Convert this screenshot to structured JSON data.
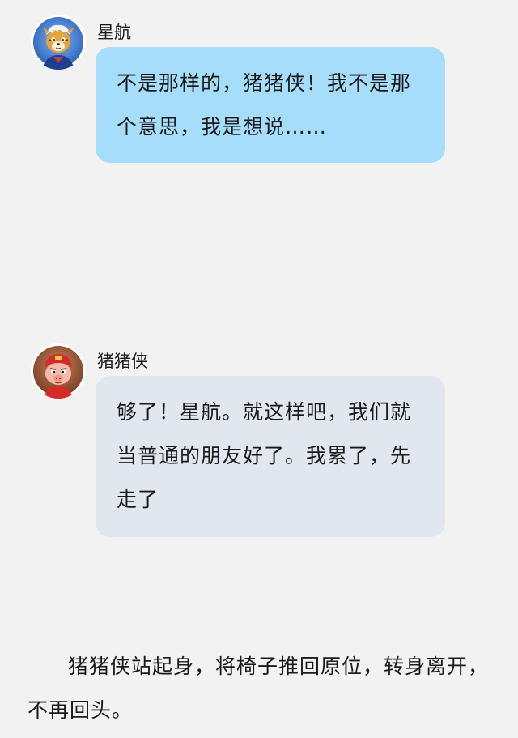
{
  "messages": [
    {
      "sender": "星航",
      "avatar_icon": "tiger-character-avatar",
      "bubble_color": "#a5ddfb",
      "text": "不是那样的，猪猪侠！我不是那个意思，我是想说……"
    },
    {
      "sender": "猪猪侠",
      "avatar_icon": "pig-hero-character-avatar",
      "bubble_color": "#e1e6ef",
      "text": "够了！星航。就这样吧，我们就当普通的朋友好了。我累了，先走了"
    }
  ],
  "narration": "猪猪侠站起身，将椅子推回原位，转身离开，不再回头。",
  "colors": {
    "background": "#f2f2f2",
    "text": "#1a1a1a"
  }
}
